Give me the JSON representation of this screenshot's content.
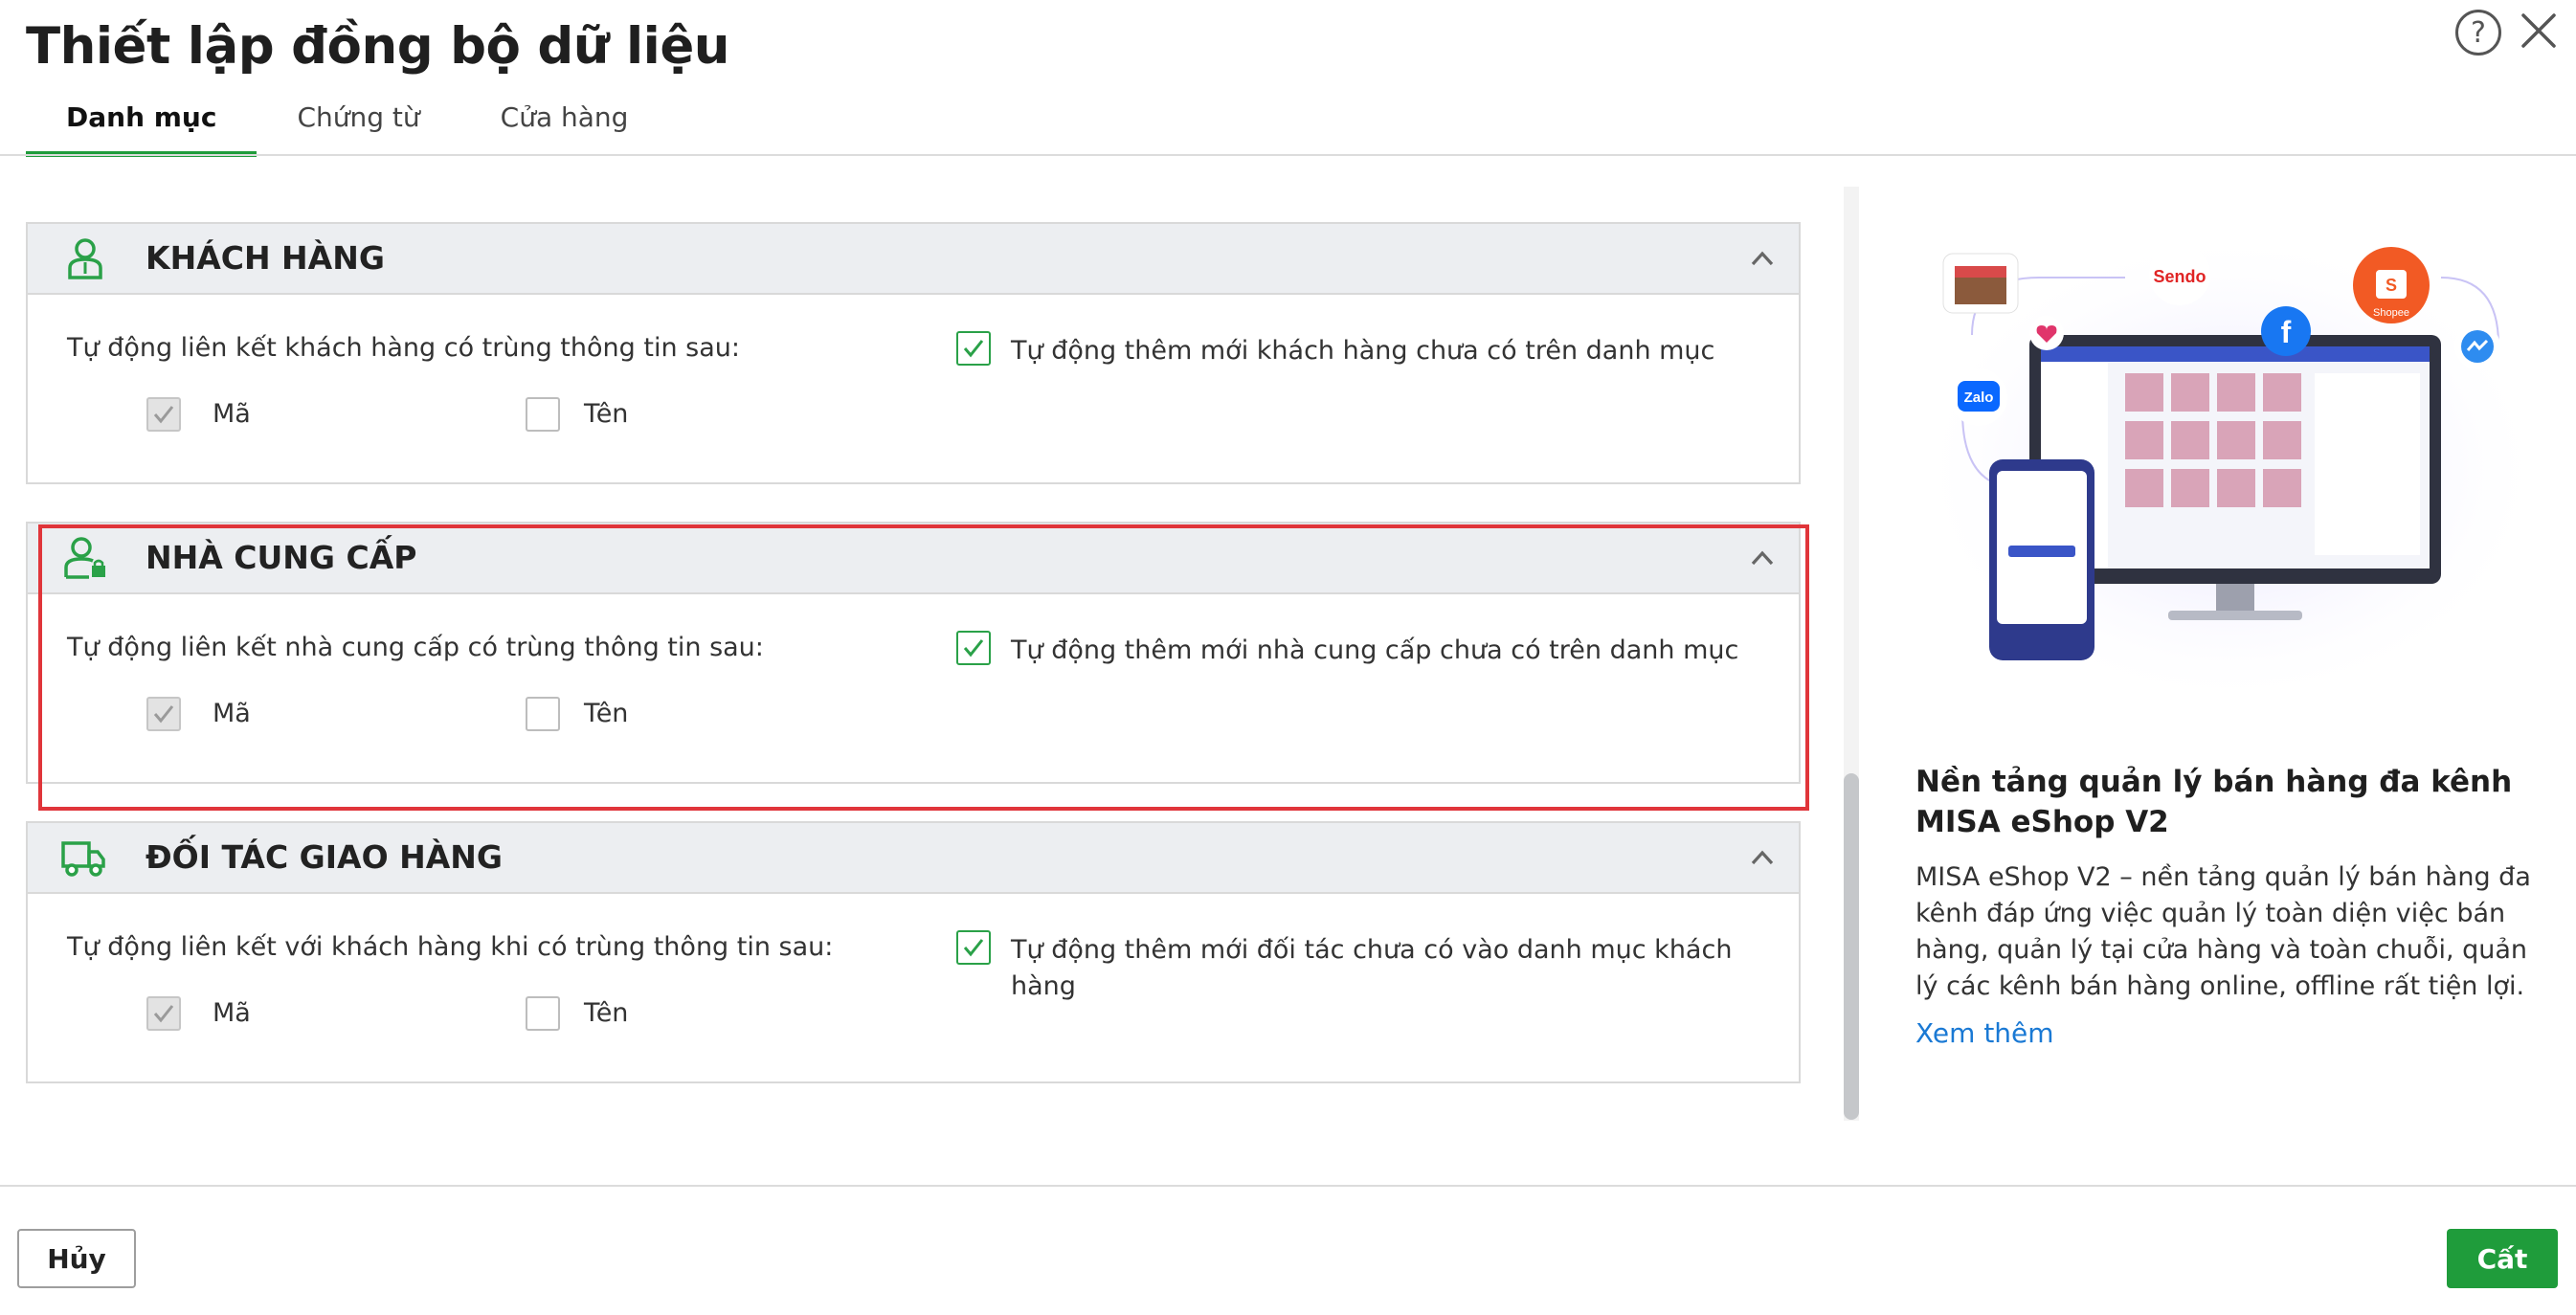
{
  "dialog": {
    "title": "Thiết lập đồng bộ dữ liệu"
  },
  "tabs": [
    {
      "label": "Danh mục",
      "active": true
    },
    {
      "label": "Chứng từ",
      "active": false
    },
    {
      "label": "Cửa hàng",
      "active": false
    }
  ],
  "sections": [
    {
      "title": "KHÁCH HÀNG",
      "icon": "customer-icon",
      "link_label": "Tự động liên kết khách hàng có trùng thông tin sau:",
      "option_ma": {
        "label": "Mã",
        "checked": true,
        "disabled": true
      },
      "option_ten": {
        "label": "Tên",
        "checked": false
      },
      "auto_add": {
        "label": "Tự động thêm mới khách hàng chưa có trên danh mục",
        "checked": true
      }
    },
    {
      "title": "NHÀ CUNG CẤP",
      "icon": "supplier-icon",
      "link_label": "Tự động liên kết nhà cung cấp có trùng thông tin sau:",
      "option_ma": {
        "label": "Mã",
        "checked": true,
        "disabled": true
      },
      "option_ten": {
        "label": "Tên",
        "checked": false
      },
      "auto_add": {
        "label": "Tự động thêm mới nhà cung cấp chưa có trên danh mục",
        "checked": true
      }
    },
    {
      "title": "ĐỐI TÁC GIAO HÀNG",
      "icon": "delivery-truck-icon",
      "link_label": "Tự động liên kết với khách hàng khi có trùng thông tin sau:",
      "option_ma": {
        "label": "Mã",
        "checked": true,
        "disabled": true
      },
      "option_ten": {
        "label": "Tên",
        "checked": false
      },
      "auto_add": {
        "label": "Tự động thêm mới đối tác chưa có vào danh mục khách hàng",
        "checked": true
      }
    }
  ],
  "promo": {
    "title": "Nền tảng quản lý bán hàng đa kênh MISA eShop V2",
    "description": "MISA eShop V2 – nền tảng quản lý bán hàng đa kênh đáp ứng việc quản lý toàn diện việc bán hàng, quản lý tại cửa hàng và toàn chuỗi, quản lý các kênh bán hàng online, offline rất tiện lợi.",
    "link": "Xem thêm",
    "illustration_labels": {
      "sendo": "Sendo",
      "shopee": "Shopee",
      "zalo": "Zalo"
    }
  },
  "footer": {
    "cancel_label": "Hủy",
    "save_label": "Cất"
  },
  "colors": {
    "accent": "#1f9c3b",
    "highlight": "#e0353a",
    "link": "#1a79d4"
  }
}
